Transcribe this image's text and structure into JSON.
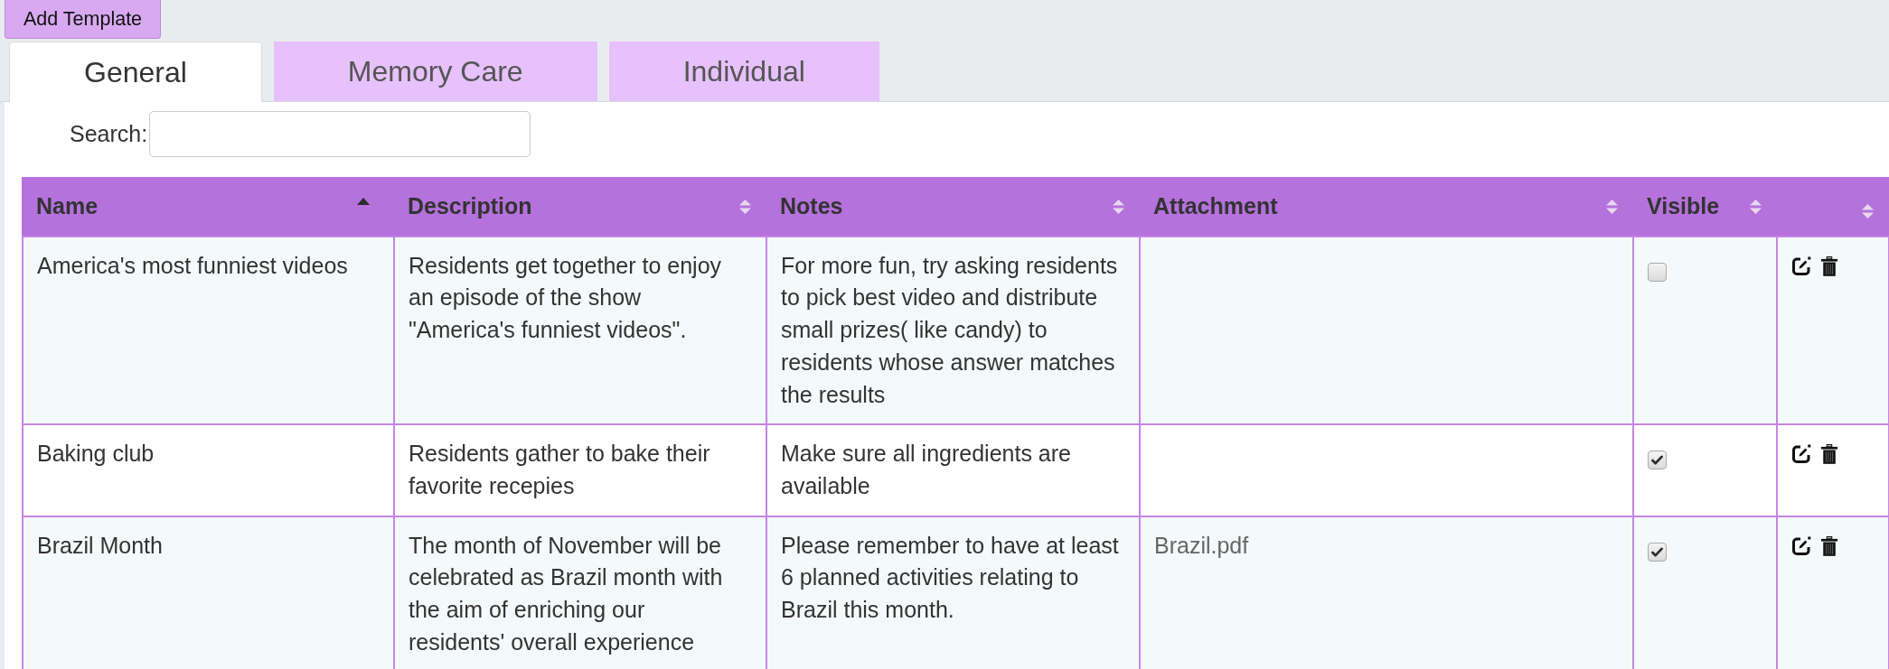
{
  "toolbar": {
    "add_button": "Add Template"
  },
  "tabs": [
    {
      "label": "General",
      "selected": true
    },
    {
      "label": "Memory Care",
      "selected": false
    },
    {
      "label": "Individual",
      "selected": false
    }
  ],
  "search": {
    "label": "Search:"
  },
  "table": {
    "columns": [
      {
        "label": "Name",
        "sorted": true
      },
      {
        "label": "Description",
        "sorted": false
      },
      {
        "label": "Notes",
        "sorted": false
      },
      {
        "label": "Attachment",
        "sorted": false
      },
      {
        "label": "Visible",
        "sorted": false
      },
      {
        "sorted": false
      }
    ],
    "rows": [
      {
        "name": "America's most funniest videos",
        "description": "Residents get together to enjoy an episode of the show \"America's funniest videos\".",
        "notes": "For more fun, try asking residents to pick best video and distribute small prizes( like candy) to residents whose answer matches the results",
        "visible": false
      },
      {
        "name": "Baking club",
        "description": "Residents gather to bake their favorite recepies",
        "notes": "Make sure all ingredients are available",
        "visible": true
      },
      {
        "name": "Brazil Month",
        "description": "The month of November will be celebrated as Brazil month with the aim of enriching our residents' overall experience",
        "notes": "Please remember to have at least 6 planned activities relating to Brazil this month.",
        "attachment": "Brazil.pdf",
        "visible": true
      }
    ]
  }
}
